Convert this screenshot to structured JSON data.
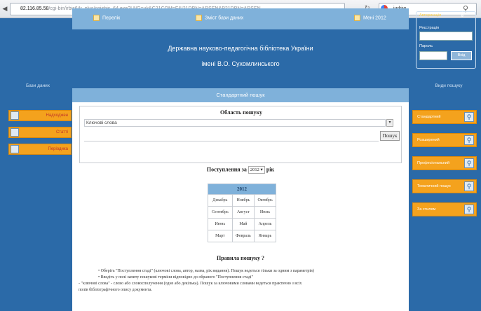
{
  "browser": {
    "url_host": "82.116.85.58",
    "url_path": "/cgi-bin/irbis64r_plus/cgiirbis_64.exe?LNG=uk&C21COM=F&I21DBN=ARSEN&P21DBN=ARSEN",
    "search_engine_text": "jurkiw",
    "back_icon": "back-arrow-icon",
    "reload_icon": "reload-icon"
  },
  "topbar": {
    "link1": "Перелік",
    "link2": "Зміст бази даних",
    "link3": "Мені 2012"
  },
  "header": {
    "line1": "Державна науково-педагогічна бібліотека України",
    "line2": "імені В.О. Сухомлинського"
  },
  "title": "Стандартний пошук",
  "left": {
    "heading": "Бази даних",
    "items": [
      "Надходжен",
      "Статті",
      "Періодика"
    ]
  },
  "login": {
    "heading": "Авторизація",
    "login_label": "Реєстрація",
    "password_label": "Пароль",
    "submit": "Вхід"
  },
  "right": {
    "heading": "Види пошуку",
    "items": [
      "Стандартний",
      "Розширений",
      "Професіональний",
      "Тематичний пошук",
      "За стилем"
    ]
  },
  "search": {
    "area_label": "Область пошуку",
    "field_value": "Ключові слова",
    "find_button": "Пошук"
  },
  "year": {
    "label_prefix": "Поступлення за",
    "year_value": "2012",
    "label_suffix": "рік"
  },
  "months": {
    "year": "2012",
    "rows": [
      [
        "Декабрь",
        "Ноябрь",
        "Октябрь"
      ],
      [
        "Сентябрь",
        "Август",
        "Июль"
      ],
      [
        "Июнь",
        "Май",
        "Апрель"
      ],
      [
        "Март",
        "Февраль",
        "Январь"
      ]
    ]
  },
  "rules": {
    "title": "Правила пошуку ?",
    "lines": [
      "• Оберіть \"Поступлення стаді\" (ключові слова, автор, назва, рік видання). Пошук ведеться тільки за одним з параметрів)",
      "• Введіть у полі запиту пошукові терміни відповідно до обраного \"Поступлення стаді\"",
      "- \"ключові слова\" - слово або словосполучення (одне або декілька). Пошук за ключовими словами ведеться практично з всіх",
      "полів бібліографічного опису документа."
    ]
  }
}
